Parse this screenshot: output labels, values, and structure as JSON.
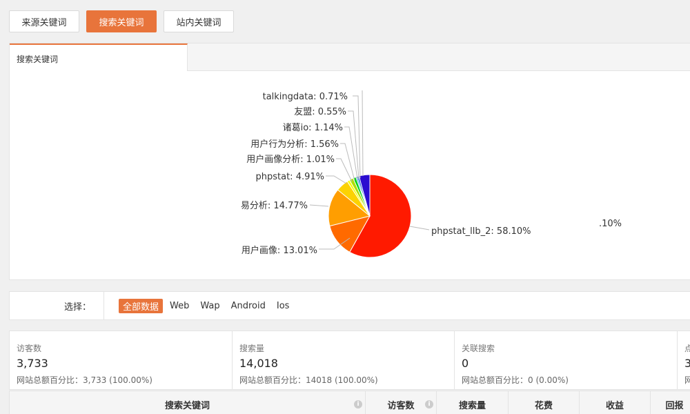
{
  "top_tabs": [
    "来源关键词",
    "搜索关键词",
    "站内关键词"
  ],
  "panel_tab": "搜索关键词",
  "chart_data": {
    "type": "pie",
    "slices": [
      {
        "label": "phpstat_llb_2",
        "value": 58.1,
        "color": "#ff1a00"
      },
      {
        "label": "用户画像",
        "value": 13.01,
        "color": "#ff6a00"
      },
      {
        "label": "易分析",
        "value": 14.77,
        "color": "#ff9e01"
      },
      {
        "label": "phpstat",
        "value": 4.91,
        "color": "#fcd202"
      },
      {
        "label": "用户画像分析",
        "value": 1.01,
        "color": "#f8ff01"
      },
      {
        "label": "用户行为分析",
        "value": 1.56,
        "color": "#b0de09"
      },
      {
        "label": "诸葛io",
        "value": 1.14,
        "color": "#04d215"
      },
      {
        "label": "友盟",
        "value": 0.55,
        "color": "#0d8ecf"
      },
      {
        "label": "talkingdata",
        "value": 0.71,
        "color": "#0d52d1"
      },
      {
        "label": "",
        "value": 4.24,
        "color": "#2a0cd0"
      }
    ],
    "labels": [
      "phpstat_llb_2: 58.10%",
      "用户画像: 13.01%",
      "易分析: 14.77%",
      "phpstat: 4.91%",
      "用户画像分析: 1.01%",
      "用户行为分析: 1.56%",
      "诸葛io: 1.14%",
      "友盟: 0.55%",
      "talkingdata: 0.71%",
      ".10%"
    ]
  },
  "filter": {
    "label": "选择：",
    "options": [
      "全部数据",
      "Web",
      "Wap",
      "Android",
      "Ios"
    ]
  },
  "stats": [
    {
      "name": "访客数",
      "value": "3,733",
      "sub": "网站总额百分比：3,733 (100.00%)"
    },
    {
      "name": "搜索量",
      "value": "14,018",
      "sub": "网站总额百分比：14018 (100.00%)"
    },
    {
      "name": "关联搜索",
      "value": "0",
      "sub": "网站总额百分比：0 (0.00%)"
    },
    {
      "name": "点",
      "value": "3",
      "sub": "网"
    }
  ],
  "table_headers": [
    "搜索关键词",
    "访客数",
    "搜索量",
    "花费",
    "收益",
    "回报"
  ],
  "icons": {
    "info": "info-icon"
  },
  "colors": {
    "accent": "#e8743b"
  }
}
